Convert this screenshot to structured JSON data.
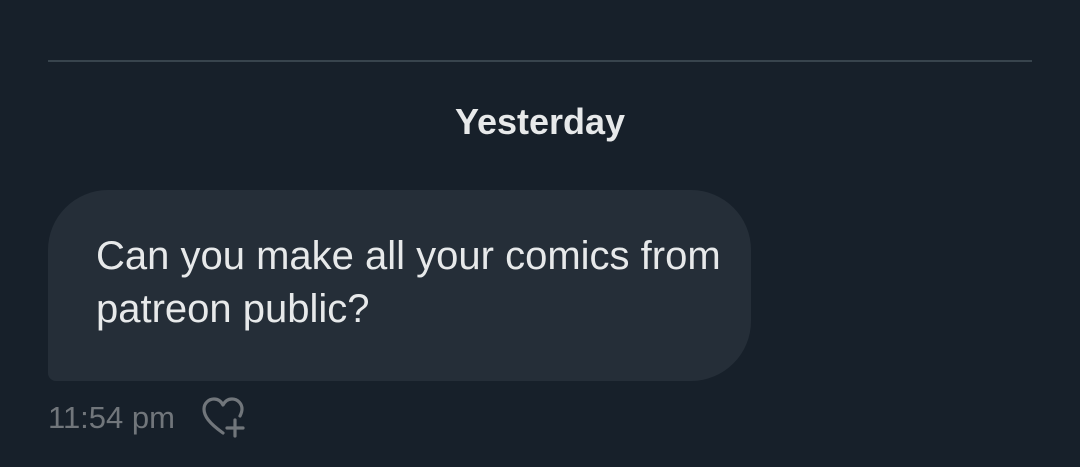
{
  "conversation": {
    "date_separator": "Yesterday",
    "messages": [
      {
        "text": "Can you make all your comics from patreon public?",
        "time": "11:54 pm",
        "reaction_icon": "heart-plus-icon"
      }
    ]
  },
  "colors": {
    "background": "#17202a",
    "bubble": "#252e38",
    "text": "#e7e9ea",
    "meta_text": "#71767b",
    "divider": "#38444d"
  }
}
